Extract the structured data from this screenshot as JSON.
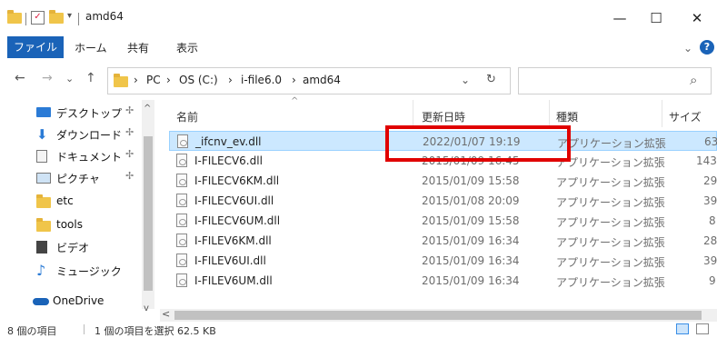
{
  "window": {
    "title": "amd64"
  },
  "titlebar": {
    "minimize": "—",
    "maximize": "☐",
    "close": "✕"
  },
  "ribbon": {
    "tabs": [
      "ファイル",
      "ホーム",
      "共有",
      "表示"
    ],
    "expand": "⌄",
    "help": "?"
  },
  "nav": {
    "back": "←",
    "forward": "→",
    "recent": "⌄",
    "up": "↑"
  },
  "address": {
    "crumbs": [
      "PC",
      "OS (C:)",
      "i-file6.0",
      "amd64"
    ],
    "separator": "›",
    "dropdown": "⌄",
    "refresh": "↻"
  },
  "search": {
    "icon": "⌕",
    "placeholder": ""
  },
  "navpane": {
    "items": [
      {
        "label": "デスクトップ",
        "icon": "desktop-icon",
        "pinned": true
      },
      {
        "label": "ダウンロード",
        "icon": "download-icon",
        "pinned": true
      },
      {
        "label": "ドキュメント",
        "icon": "document-icon",
        "pinned": true
      },
      {
        "label": "ピクチャ",
        "icon": "pictures-icon",
        "pinned": true
      },
      {
        "label": "etc",
        "icon": "folder-icon",
        "pinned": false
      },
      {
        "label": "tools",
        "icon": "folder-icon",
        "pinned": false
      },
      {
        "label": "ビデオ",
        "icon": "video-icon",
        "pinned": false
      },
      {
        "label": "ミュージック",
        "icon": "music-icon",
        "pinned": false
      },
      {
        "label": "OneDrive",
        "icon": "cloud-icon",
        "pinned": false
      }
    ],
    "pin_glyph": "✢"
  },
  "columns": {
    "name": "名前",
    "date": "更新日時",
    "type": "種類",
    "size": "サイズ"
  },
  "files": [
    {
      "name": "_ifcnv_ev.dll",
      "date": "2022/01/07 19:19",
      "type": "アプリケーション拡張",
      "size": "63",
      "selected": true
    },
    {
      "name": "I-FILECV6.dll",
      "date": "2015/01/09 16:45",
      "type": "アプリケーション拡張",
      "size": "143",
      "selected": false
    },
    {
      "name": "I-FILECV6KM.dll",
      "date": "2015/01/09 15:58",
      "type": "アプリケーション拡張",
      "size": "29",
      "selected": false
    },
    {
      "name": "I-FILECV6UI.dll",
      "date": "2015/01/08 20:09",
      "type": "アプリケーション拡張",
      "size": "39",
      "selected": false
    },
    {
      "name": "I-FILECV6UM.dll",
      "date": "2015/01/09 15:58",
      "type": "アプリケーション拡張",
      "size": "8",
      "selected": false
    },
    {
      "name": "I-FILEV6KM.dll",
      "date": "2015/01/09 16:34",
      "type": "アプリケーション拡張",
      "size": "28",
      "selected": false
    },
    {
      "name": "I-FILEV6UI.dll",
      "date": "2015/01/09 16:34",
      "type": "アプリケーション拡張",
      "size": "39",
      "selected": false
    },
    {
      "name": "I-FILEV6UM.dll",
      "date": "2015/01/09 16:34",
      "type": "アプリケーション拡張",
      "size": "9",
      "selected": false
    }
  ],
  "status": {
    "count": "8 個の項目",
    "selection": "1 個の項目を選択 62.5 KB"
  },
  "colors": {
    "accent": "#1a63b8",
    "selection": "#cce8ff",
    "highlight": "#e00000"
  }
}
